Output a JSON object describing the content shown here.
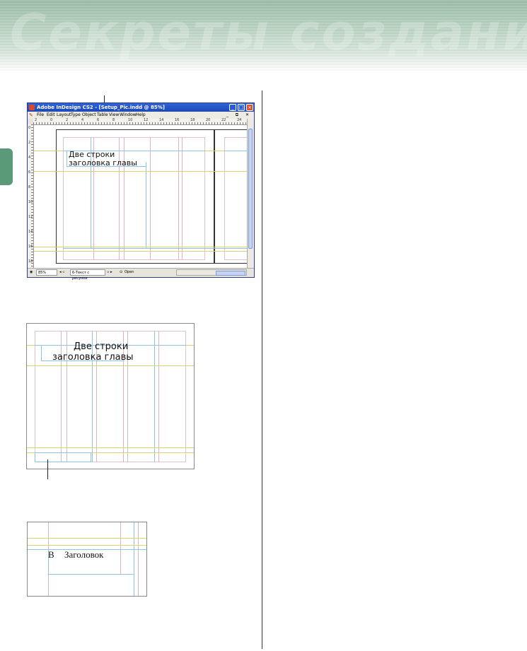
{
  "banner": {
    "text": "Секреты создания стил"
  },
  "window": {
    "title": "Adobe InDesign CS2 - [Setup_Pic.indd @ 85%]",
    "menu": [
      "File",
      "Edit",
      "Layout",
      "Type",
      "Object",
      "Table",
      "View",
      "Window",
      "Help"
    ],
    "menu_right": "_ ⧉ ✕",
    "ruler_ticks_h": [
      "2",
      "0",
      "2",
      "4",
      "6",
      "8",
      "10",
      "12",
      "14",
      "16",
      "18",
      "20",
      "22",
      "24"
    ],
    "ruler_ticks_v": [
      "0",
      "2",
      "4",
      "6",
      "8",
      "10",
      "12",
      "14",
      "16",
      "18"
    ],
    "status": {
      "zoom": "85%",
      "page": "6-Текст с рисунки",
      "state": "Open"
    }
  },
  "figure1": {
    "heading_line1": "Две строки",
    "heading_line2": "заголовка главы"
  },
  "figure2": {
    "heading_line1": "Две строки",
    "heading_line2": "заголовка главы"
  },
  "figure3": {
    "letter": "В",
    "heading": "Заголовок"
  },
  "colors": {
    "banner": "#b7d1c0",
    "side_tab": "#5b9a79",
    "guide_yellow": "#d9d36a",
    "guide_blue": "#8fc3e3",
    "guide_pink": "#e0b3c8",
    "titlebar": "#2e63d8"
  }
}
